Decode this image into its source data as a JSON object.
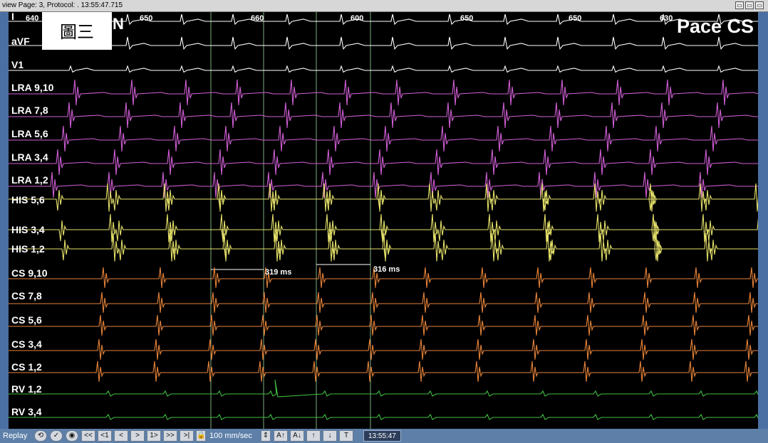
{
  "header": {
    "text": "view Page: 3, Protocol: .   13:55:47.715",
    "window_buttons": [
      "▭",
      "▭",
      "▭"
    ]
  },
  "figure_label": "圖三",
  "mode_title": "Pace CS",
  "lead_suffix": "N",
  "cycle_lengths": [
    "640",
    "650",
    "660",
    "600",
    "650",
    "650",
    "630"
  ],
  "channels": [
    {
      "name": "I",
      "color": "#ffffff",
      "kind": "surface"
    },
    {
      "name": "aVF",
      "color": "#ffffff",
      "kind": "surface"
    },
    {
      "name": "V1",
      "color": "#ffffff",
      "kind": "surface"
    },
    {
      "name": "LRA 9,10",
      "color": "#d15fd6",
      "kind": "atrial"
    },
    {
      "name": "LRA 7,8",
      "color": "#d15fd6",
      "kind": "atrial"
    },
    {
      "name": "LRA 5,6",
      "color": "#d15fd6",
      "kind": "atrial"
    },
    {
      "name": "LRA 3,4",
      "color": "#d15fd6",
      "kind": "atrial"
    },
    {
      "name": "LRA 1,2",
      "color": "#d15fd6",
      "kind": "atrial"
    },
    {
      "name": "HIS 5,6",
      "color": "#e6e26a",
      "kind": "his"
    },
    {
      "name": "HIS 3,4",
      "color": "#e6e26a",
      "kind": "his"
    },
    {
      "name": "HIS 1,2",
      "color": "#e6e26a",
      "kind": "his"
    },
    {
      "name": "CS 9,10",
      "color": "#e8843a",
      "kind": "cs"
    },
    {
      "name": "CS 7,8",
      "color": "#e8843a",
      "kind": "cs"
    },
    {
      "name": "CS 5,6",
      "color": "#e8843a",
      "kind": "cs"
    },
    {
      "name": "CS 3,4",
      "color": "#e8843a",
      "kind": "cs"
    },
    {
      "name": "CS 1,2",
      "color": "#e8843a",
      "kind": "cs"
    },
    {
      "name": "RV 1,2",
      "color": "#3fbf3f",
      "kind": "rv"
    },
    {
      "name": "RV 3,4",
      "color": "#3fbf3f",
      "kind": "rv"
    }
  ],
  "measurements": [
    {
      "label": "319 ms"
    },
    {
      "label": "316 ms"
    }
  ],
  "toolbar": {
    "replay_label": "Replay",
    "buttons": [
      "<<",
      "<1",
      "<",
      ">",
      "1>",
      ">>",
      ">|"
    ],
    "speed_label": "100 mm/sec",
    "tool_buttons": [
      "A↑",
      "A↓",
      "↑",
      "↓",
      "T"
    ],
    "time": "13:55:47"
  }
}
